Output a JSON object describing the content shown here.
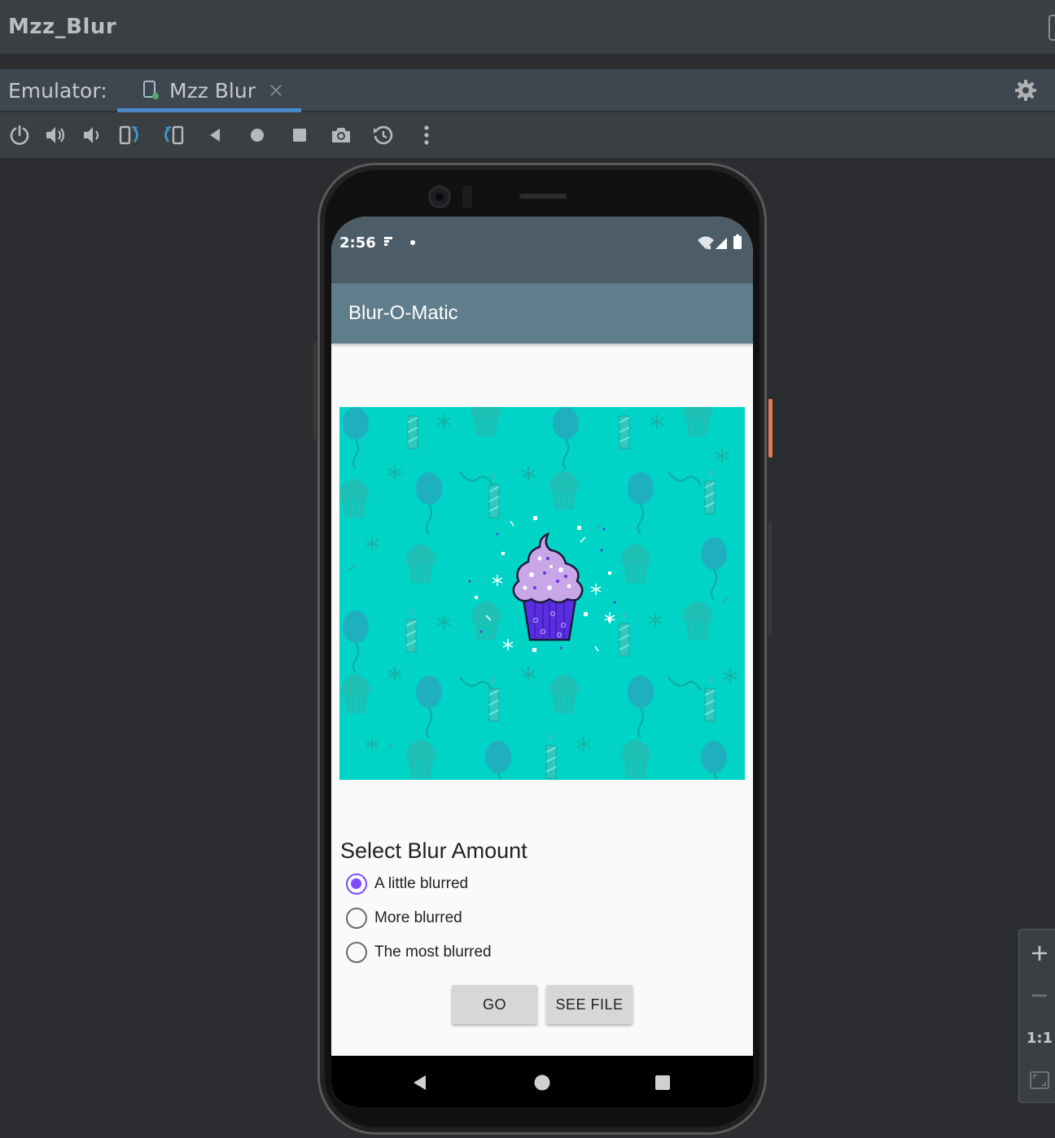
{
  "window": {
    "title": "Mzz_Blur"
  },
  "tabbar": {
    "label": "Emulator:",
    "tab_title": "Mzz Blur"
  },
  "toolbar": {
    "icons": [
      "power-icon",
      "volume-up-icon",
      "volume-down-icon",
      "rotate-left-icon",
      "rotate-right-icon",
      "back-icon",
      "home-icon",
      "overview-icon",
      "screenshot-icon",
      "snapshot-icon",
      "more-icon"
    ]
  },
  "device": {
    "status": {
      "time": "2:56"
    },
    "app": {
      "title": "Blur-O-Matic",
      "heading": "Select Blur Amount",
      "options": [
        {
          "label": "A little blurred",
          "selected": true
        },
        {
          "label": "More blurred",
          "selected": false
        },
        {
          "label": "The most blurred",
          "selected": false
        }
      ],
      "go_label": "GO",
      "see_file_label": "SEE FILE"
    }
  },
  "zoom": {
    "one_to_one": "1:1"
  },
  "colors": {
    "accent": "#7c4dff",
    "appbar": "#607d8b",
    "statusbar": "#4d5d67",
    "hero_bg": "#00d4c6"
  }
}
